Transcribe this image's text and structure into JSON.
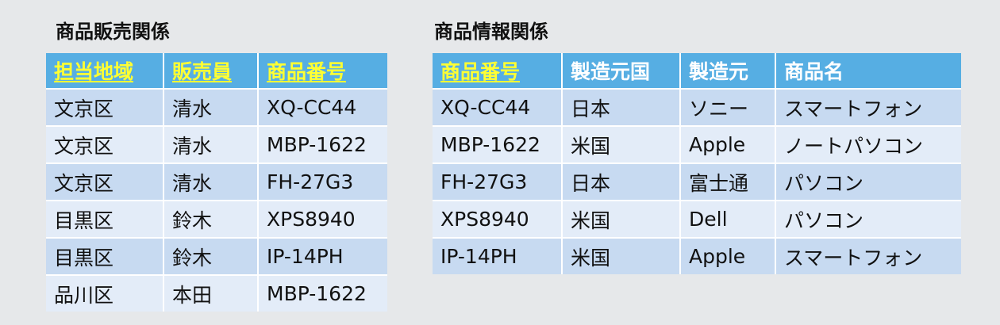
{
  "left_table": {
    "title": "商品販売関係",
    "headers": [
      "担当地域",
      "販売員",
      "商品番号"
    ],
    "rows": [
      [
        "文京区",
        "清水",
        "XQ-CC44"
      ],
      [
        "文京区",
        "清水",
        "MBP-1622"
      ],
      [
        "文京区",
        "清水",
        "FH-27G3"
      ],
      [
        "目黒区",
        "鈴木",
        "XPS8940"
      ],
      [
        "目黒区",
        "鈴木",
        "IP-14PH"
      ],
      [
        "品川区",
        "本田",
        "MBP-1622"
      ]
    ]
  },
  "right_table": {
    "title": "商品情報関係",
    "headers": [
      "商品番号",
      "製造元国",
      "製造元",
      "商品名"
    ],
    "rows": [
      [
        "XQ-CC44",
        "日本",
        "ソニー",
        "スマートフォン"
      ],
      [
        "MBP-1622",
        "米国",
        "Apple",
        "ノートパソコン"
      ],
      [
        "FH-27G3",
        "日本",
        "富士通",
        "パソコン"
      ],
      [
        "XPS8940",
        "米国",
        "Dell",
        "パソコン"
      ],
      [
        "IP-14PH",
        "米国",
        "Apple",
        "スマートフォン"
      ]
    ]
  },
  "colors": {
    "header_bg": "#56aee3",
    "key_header_text": "#ffff33",
    "row_odd_bg": "#c7daf1",
    "row_even_bg": "#e3ecf8",
    "page_bg": "#e6e8ea"
  }
}
